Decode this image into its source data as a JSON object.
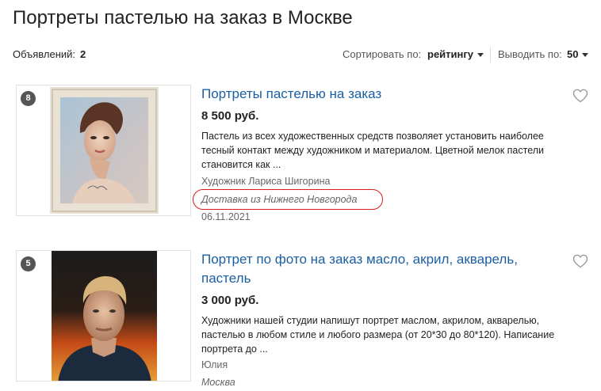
{
  "page": {
    "title": "Портреты пастелью на заказ в Москве"
  },
  "toolbar": {
    "count_label": "Объявлений:",
    "count_value": "2",
    "sort_label": "Сортировать по:",
    "sort_value": "рейтингу",
    "per_page_label": "Выводить по:",
    "per_page_value": "50"
  },
  "listings": [
    {
      "badge": "8",
      "title": "Портреты пастелью на заказ",
      "price": "8 500 руб.",
      "description": "Пастель из всех художественных средств позволяет установить наиболее тесный контакт между художником и материалом. Цветной мелок пастели становится как ...",
      "author": "Художник Лариса Шигорина",
      "location": "Доставка из Нижнего Новгорода",
      "date": "06.11.2021",
      "image_icon": "pastel-portrait-woman-image",
      "favorite_icon": "heart-icon"
    },
    {
      "badge": "5",
      "title": "Портрет по фото на заказ масло, акрил, акварель, пастель",
      "price": "3 000 руб.",
      "description": "Художники нашей студии напишут портрет маслом, акрилом, акварелью, пастелью в любом стиле и любого размера (от 20*30 до 80*120). Написание портрета до ...",
      "author": "Юлия",
      "location": "Москва",
      "image_icon": "oil-portrait-man-image",
      "favorite_icon": "heart-icon"
    }
  ],
  "colors": {
    "link": "#1a5ea3",
    "highlight": "#d61f1f",
    "badge": "#555555"
  }
}
